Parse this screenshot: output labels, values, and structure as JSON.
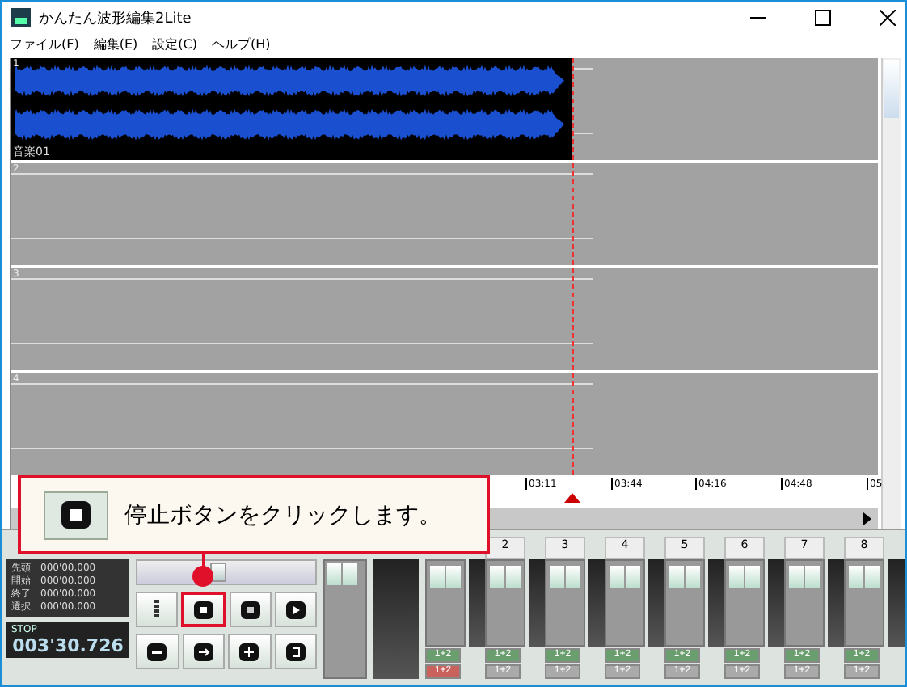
{
  "window": {
    "title": "かんたん波形編集2Lite"
  },
  "menu": [
    "ファイル(F)",
    "編集(E)",
    "設定(C)",
    "ヘルプ(H)"
  ],
  "tracks": [
    {
      "number": "1",
      "label": "音楽01",
      "has_audio": true
    },
    {
      "number": "2",
      "has_audio": false
    },
    {
      "number": "3",
      "has_audio": false
    },
    {
      "number": "4",
      "has_audio": false
    }
  ],
  "ruler": [
    "03:11",
    "03:44",
    "04:16",
    "04:48",
    "05"
  ],
  "info": [
    {
      "label": "先頭",
      "value": "000'00.000"
    },
    {
      "label": "開始",
      "value": "000'00.000"
    },
    {
      "label": "終了",
      "value": "000'00.000"
    },
    {
      "label": "選択",
      "value": "000'00.000"
    }
  ],
  "seek": {
    "level": 0.45
  },
  "status": "STOP",
  "time": "003'30.726",
  "transport": [
    [
      {
        "kind": "pitch",
        "highlighted": false
      },
      {
        "kind": "stop",
        "highlighted": true
      },
      {
        "kind": "pause",
        "highlighted": false
      },
      {
        "kind": "play",
        "highlighted": false
      }
    ],
    [
      {
        "kind": "minus",
        "highlighted": false
      },
      {
        "kind": "arrow",
        "highlighted": false
      },
      {
        "kind": "plus",
        "highlighted": false
      },
      {
        "kind": "loop",
        "highlighted": false
      }
    ]
  ],
  "channels": [
    {
      "upper": "1+2",
      "lower": "1+2",
      "lower_on": true
    },
    {
      "number": "2",
      "upper": "1+2",
      "lower": "1+2",
      "lower_on": false
    },
    {
      "number": "3",
      "upper": "1+2",
      "lower": "1+2",
      "lower_on": false
    },
    {
      "number": "4",
      "upper": "1+2",
      "lower": "1+2",
      "lower_on": false
    },
    {
      "number": "5",
      "upper": "1+2",
      "lower": "1+2",
      "lower_on": false
    },
    {
      "number": "6",
      "upper": "1+2",
      "lower": "1+2",
      "lower_on": false
    },
    {
      "number": "7",
      "upper": "1+2",
      "lower": "1+2",
      "lower_on": false
    },
    {
      "number": "8",
      "upper": "1+2",
      "lower": "1+2",
      "lower_on": false
    }
  ],
  "callout": {
    "text": "停止ボタンをクリックします。"
  }
}
